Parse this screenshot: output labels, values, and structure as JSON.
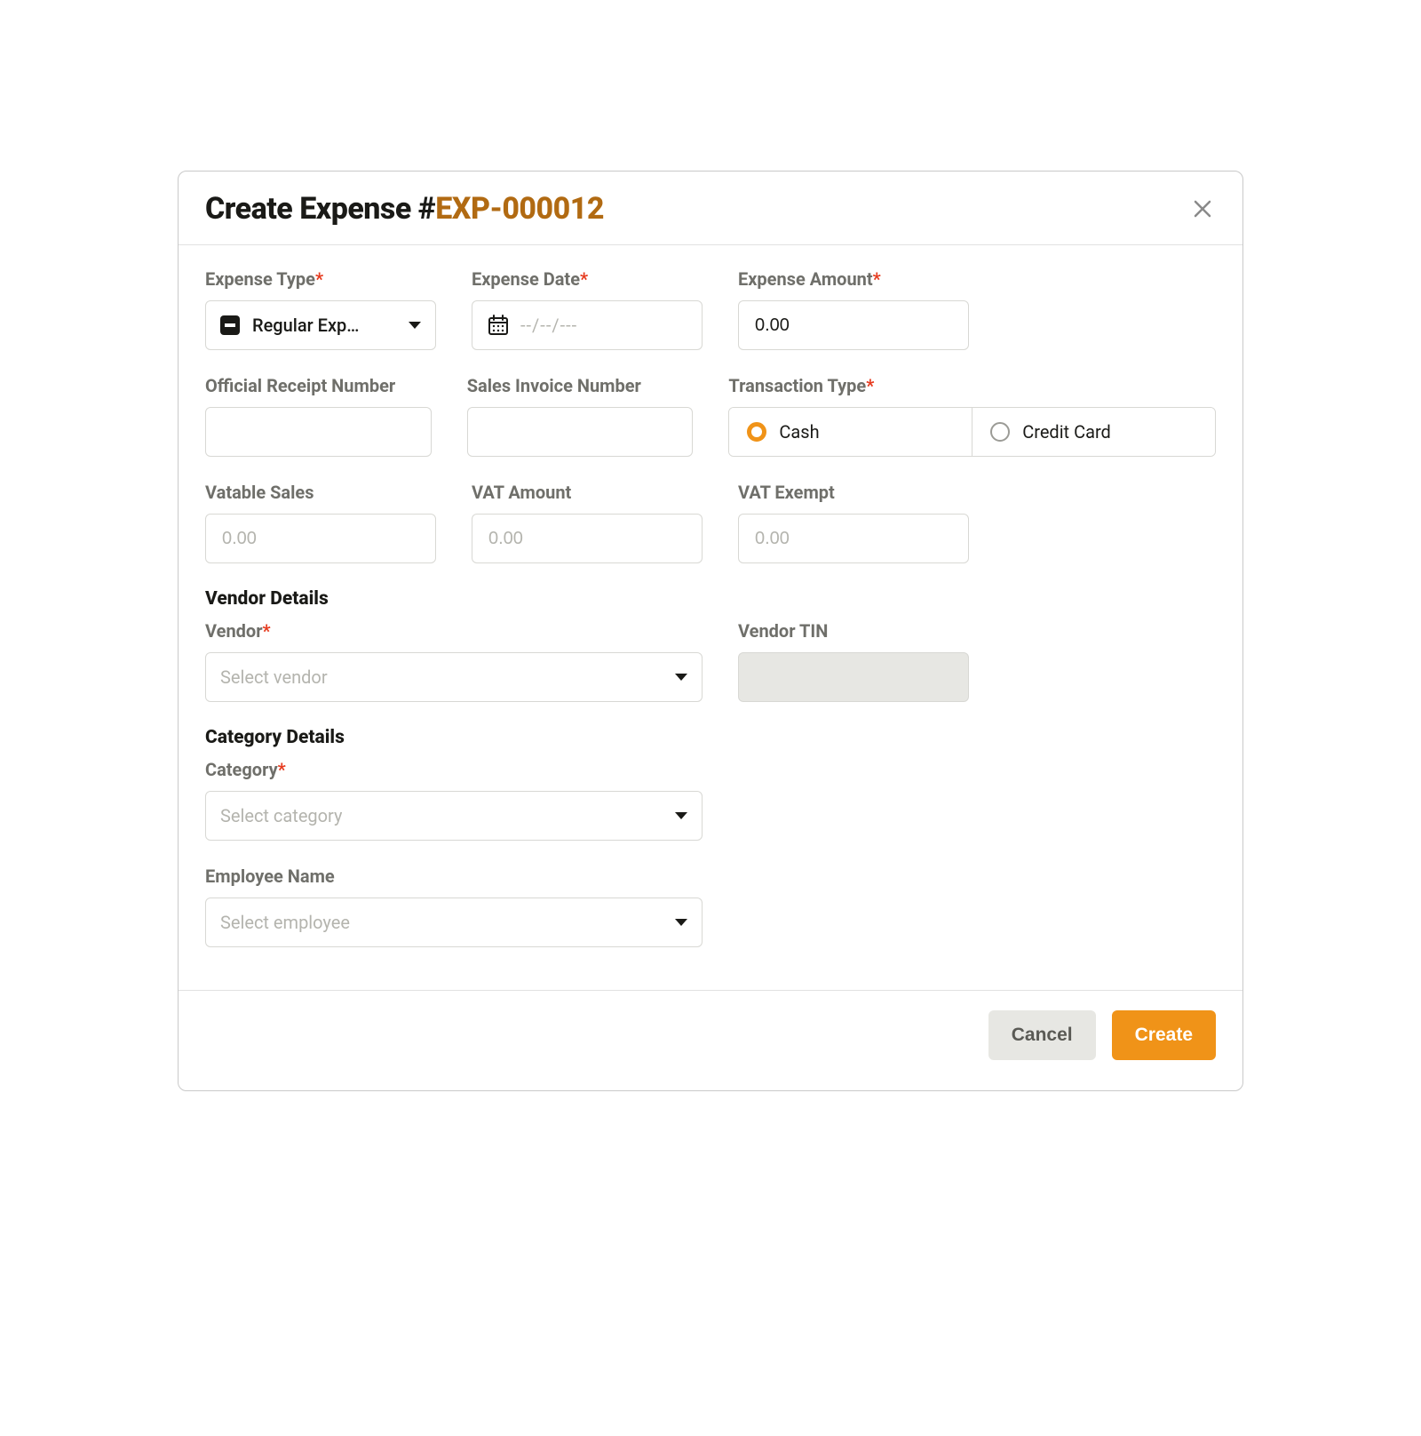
{
  "header": {
    "title_prefix": "Create Expense #",
    "expense_no": "EXP-000012"
  },
  "labels": {
    "expense_type": "Expense Type",
    "expense_date": "Expense Date",
    "expense_amount": "Expense Amount",
    "orn": "Official Receipt Number",
    "sin": "Sales Invoice Number",
    "transaction_type": "Transaction Type",
    "vatable_sales": "Vatable Sales",
    "vat_amount": "VAT Amount",
    "vat_exempt": "VAT Exempt",
    "vendor_section": "Vendor Details",
    "vendor": "Vendor",
    "vendor_tin": "Vendor TIN",
    "category_section": "Category Details",
    "category": "Category",
    "employee": "Employee Name"
  },
  "values": {
    "expense_type_selected": "Regular Exp…",
    "expense_amount": "0.00",
    "orn": "",
    "sin": "",
    "vendor_tin": ""
  },
  "placeholders": {
    "date": "--/--/---",
    "zero": "0.00",
    "select_vendor": "Select vendor",
    "select_category": "Select category",
    "select_employee": "Select employee"
  },
  "transaction": {
    "cash": "Cash",
    "credit": "Credit Card",
    "selected": "cash"
  },
  "footer": {
    "cancel": "Cancel",
    "create": "Create"
  }
}
